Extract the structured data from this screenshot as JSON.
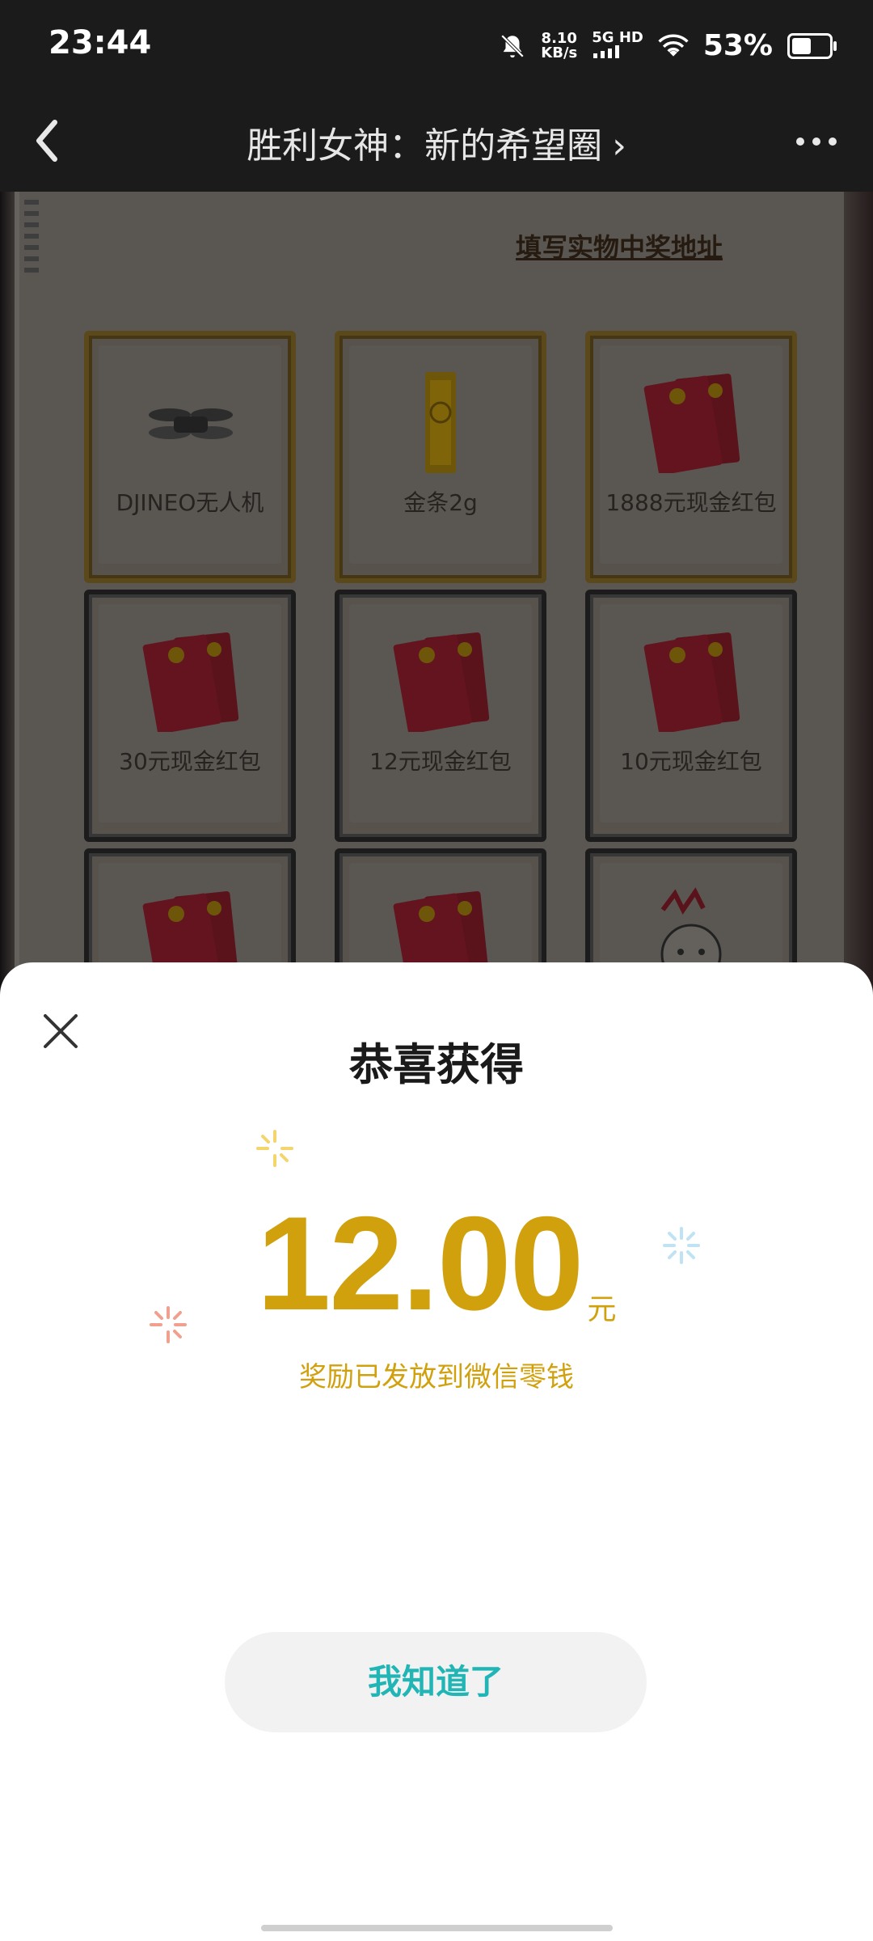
{
  "status_bar": {
    "time": "23:44",
    "net_speed_value": "8.10",
    "net_speed_unit": "KB/s",
    "signal_label": "5G HD",
    "battery_percent": "53%",
    "battery_level": 0.53
  },
  "nav": {
    "title": "胜利女神：新的希望圈",
    "title_chevron": "›"
  },
  "prize_panel": {
    "address_link": "填写实物中奖地址",
    "cards": [
      {
        "label": "DJINEO无人机",
        "icon": "drone-icon",
        "frame": "gold"
      },
      {
        "label": "金条2g",
        "icon": "gold-bar-icon",
        "frame": "gold"
      },
      {
        "label": "1888元现金红包",
        "icon": "red-envelope-icon",
        "frame": "gold"
      },
      {
        "label": "30元现金红包",
        "icon": "red-envelope-icon",
        "frame": "dark"
      },
      {
        "label": "12元现金红包",
        "icon": "red-envelope-icon",
        "frame": "dark"
      },
      {
        "label": "10元现金红包",
        "icon": "red-envelope-icon",
        "frame": "dark"
      },
      {
        "label": "",
        "icon": "red-envelope-icon",
        "frame": "dark"
      },
      {
        "label": "",
        "icon": "red-envelope-icon",
        "frame": "dark"
      },
      {
        "label": "",
        "icon": "cartoon-sticker-icon",
        "frame": "dark"
      }
    ]
  },
  "sheet": {
    "title": "恭喜获得",
    "amount": "12.00",
    "unit": "元",
    "note": "奖励已发放到微信零钱",
    "ok_label": "我知道了"
  },
  "colors": {
    "accent_gold": "#d1a10d",
    "button_text": "#22b5b5",
    "envelope_red": "#c8102e"
  }
}
